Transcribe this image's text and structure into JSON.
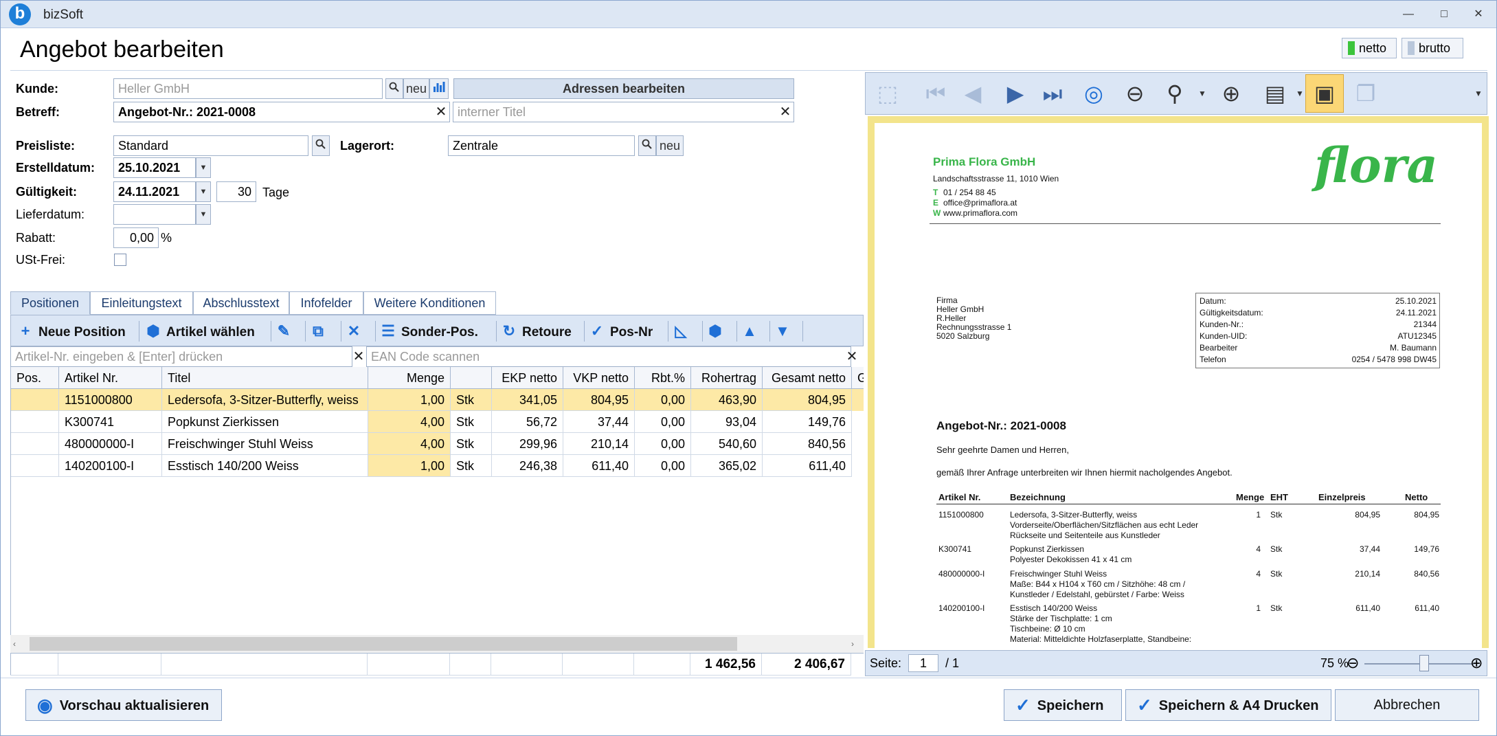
{
  "window": {
    "app_title": "bizSoft",
    "logo_letter": "b",
    "min": "—",
    "max": "□",
    "close": "✕"
  },
  "header": {
    "title": "Angebot bearbeiten",
    "toggle_netto": "netto",
    "toggle_brutto": "brutto",
    "netto_color": "#3cc43c",
    "brutto_color": "#b9c7db"
  },
  "form": {
    "kunde_label": "Kunde:",
    "kunde_value": "Heller GmbH",
    "neu": "neu",
    "adressen_button": "Adressen bearbeiten",
    "betreff_label": "Betreff:",
    "betreff_value": "Angebot-Nr.: 2021-0008",
    "intern_placeholder": "interner Titel",
    "preisliste_label": "Preisliste:",
    "preisliste_value": "Standard",
    "lagerort_label": "Lagerort:",
    "lagerort_value": "Zentrale",
    "erstelldatum_label": "Erstelldatum:",
    "erstelldatum_value": "25.10.2021",
    "gueltigkeit_label": "Gültigkeit:",
    "gueltigkeit_value": "24.11.2021",
    "tage_value": "30",
    "tage_label": "Tage",
    "lieferdatum_label": "Lieferdatum:",
    "lieferdatum_value": "",
    "rabatt_label": "Rabatt:",
    "rabatt_value": "0,00",
    "rabatt_unit": "%",
    "ustfrei_label": "USt-Frei:"
  },
  "tabs": [
    "Positionen",
    "Einleitungstext",
    "Abschlusstext",
    "Infofelder",
    "Weitere Konditionen"
  ],
  "toolbar": {
    "neue_position": "Neue Position",
    "artikel_waehlen": "Artikel wählen",
    "sonder_pos": "Sonder-Pos.",
    "retoure": "Retoure",
    "pos_nr": "Pos-Nr"
  },
  "filter": {
    "artikel_placeholder": "Artikel-Nr. eingeben & [Enter] drücken",
    "ean_placeholder": "EAN Code scannen"
  },
  "grid": {
    "columns": [
      "Pos.",
      "Artikel Nr.",
      "Titel",
      "Menge",
      "",
      "EKP netto",
      "VKP netto",
      "Rbt.%",
      "Rohertrag",
      "Gesamt netto",
      "Ge"
    ],
    "rows": [
      {
        "pos": "",
        "artikel": "1151000800",
        "titel": "Ledersofa, 3-Sitzer-Butterfly, weiss",
        "menge": "1,00",
        "einheit": "Stk",
        "ekp": "341,05",
        "vkp": "804,95",
        "rbt": "0,00",
        "rohertrag": "463,90",
        "gesamt": "804,95"
      },
      {
        "pos": "",
        "artikel": "K300741",
        "titel": "Popkunst Zierkissen",
        "menge": "4,00",
        "einheit": "Stk",
        "ekp": "56,72",
        "vkp": "37,44",
        "rbt": "0,00",
        "rohertrag": "93,04",
        "gesamt": "149,76"
      },
      {
        "pos": "",
        "artikel": "480000000-I",
        "titel": "Freischwinger Stuhl Weiss",
        "menge": "4,00",
        "einheit": "Stk",
        "ekp": "299,96",
        "vkp": "210,14",
        "rbt": "0,00",
        "rohertrag": "540,60",
        "gesamt": "840,56"
      },
      {
        "pos": "",
        "artikel": "140200100-I",
        "titel": "Esstisch 140/200 Weiss",
        "menge": "1,00",
        "einheit": "Stk",
        "ekp": "246,38",
        "vkp": "611,40",
        "rbt": "0,00",
        "rohertrag": "365,02",
        "gesamt": "611,40"
      }
    ],
    "sum_rohertrag": "1 462,56",
    "sum_gesamt": "2 406,67",
    "selected_color": "#fde9a6",
    "menge_color": "#fde9a6"
  },
  "preview": {
    "company": "Prima Flora GmbH",
    "address": "Landschaftsstrasse 11, 1010 Wien",
    "t_label": "T",
    "t_value": "01 / 254 88 45",
    "e_label": "E",
    "e_value": "office@primaflora.at",
    "w_label": "W",
    "w_value": "www.primaflora.com",
    "logo_text": "flora",
    "recipient": [
      "Firma",
      "Heller GmbH",
      "R.Heller",
      "Rechnungsstrasse  1",
      "5020  Salzburg"
    ],
    "info": [
      {
        "k": "Datum:",
        "v": "25.10.2021"
      },
      {
        "k": "Gültigkeitsdatum:",
        "v": "24.11.2021"
      },
      {
        "k": "Kunden-Nr.:",
        "v": "21344"
      },
      {
        "k": "Kunden-UID:",
        "v": "ATU12345"
      },
      {
        "k": "Bearbeiter",
        "v": "M. Baumann"
      },
      {
        "k": "Telefon",
        "v": "0254 / 5478 998 DW45"
      }
    ],
    "doc_title": "Angebot-Nr.: 2021-0008",
    "greeting": "Sehr geehrte Damen und Herren,",
    "intro": "gemäß Ihrer Anfrage unterbreiten wir Ihnen hiermit nacholgendes Angebot.",
    "table_head": {
      "artikel": "Artikel Nr.",
      "bez": "Bezeichnung",
      "menge": "Menge",
      "eht": "EHT",
      "einzel": "Einzelpreis",
      "netto": "Netto"
    },
    "items": [
      {
        "artikel": "1151000800",
        "lines": [
          "Ledersofa, 3-Sitzer-Butterfly, weiss",
          "Vorderseite/Oberflächen/Sitzflächen aus echt Leder",
          "Rückseite und Seitenteile aus Kunstleder"
        ],
        "menge": "1",
        "eht": "Stk",
        "einzel": "804,95",
        "netto": "804,95"
      },
      {
        "artikel": "K300741",
        "lines": [
          "Popkunst Zierkissen",
          "Polyester Dekokissen 41 x 41 cm"
        ],
        "menge": "4",
        "eht": "Stk",
        "einzel": "37,44",
        "netto": "149,76"
      },
      {
        "artikel": "480000000-I",
        "lines": [
          "Freischwinger Stuhl Weiss",
          "Maße: B44 x H104 x T60 cm / Sitzhöhe: 48 cm /",
          "Kunstleder / Edelstahl, gebürstet / Farbe: Weiss"
        ],
        "menge": "4",
        "eht": "Stk",
        "einzel": "210,14",
        "netto": "840,56"
      },
      {
        "artikel": "140200100-I",
        "lines": [
          "Esstisch 140/200 Weiss",
          "Stärke der Tischplatte: 1 cm",
          "Tischbeine: Ø 10 cm",
          "Material: Mitteldichte Holzfaserplatte, Standbeine:"
        ],
        "menge": "1",
        "eht": "Stk",
        "einzel": "611,40",
        "netto": "611,40"
      }
    ],
    "company_color": "#39b54a"
  },
  "preview_status": {
    "seite_label": "Seite:",
    "seite_value": "1",
    "total": "/ 1",
    "zoom": "75 %",
    "zoom_level": 0.55
  },
  "footer": {
    "vorschau": "Vorschau aktualisieren",
    "speichern": "Speichern",
    "speichern_drucken": "Speichern & A4 Drucken",
    "abbrechen": "Abbrechen"
  }
}
